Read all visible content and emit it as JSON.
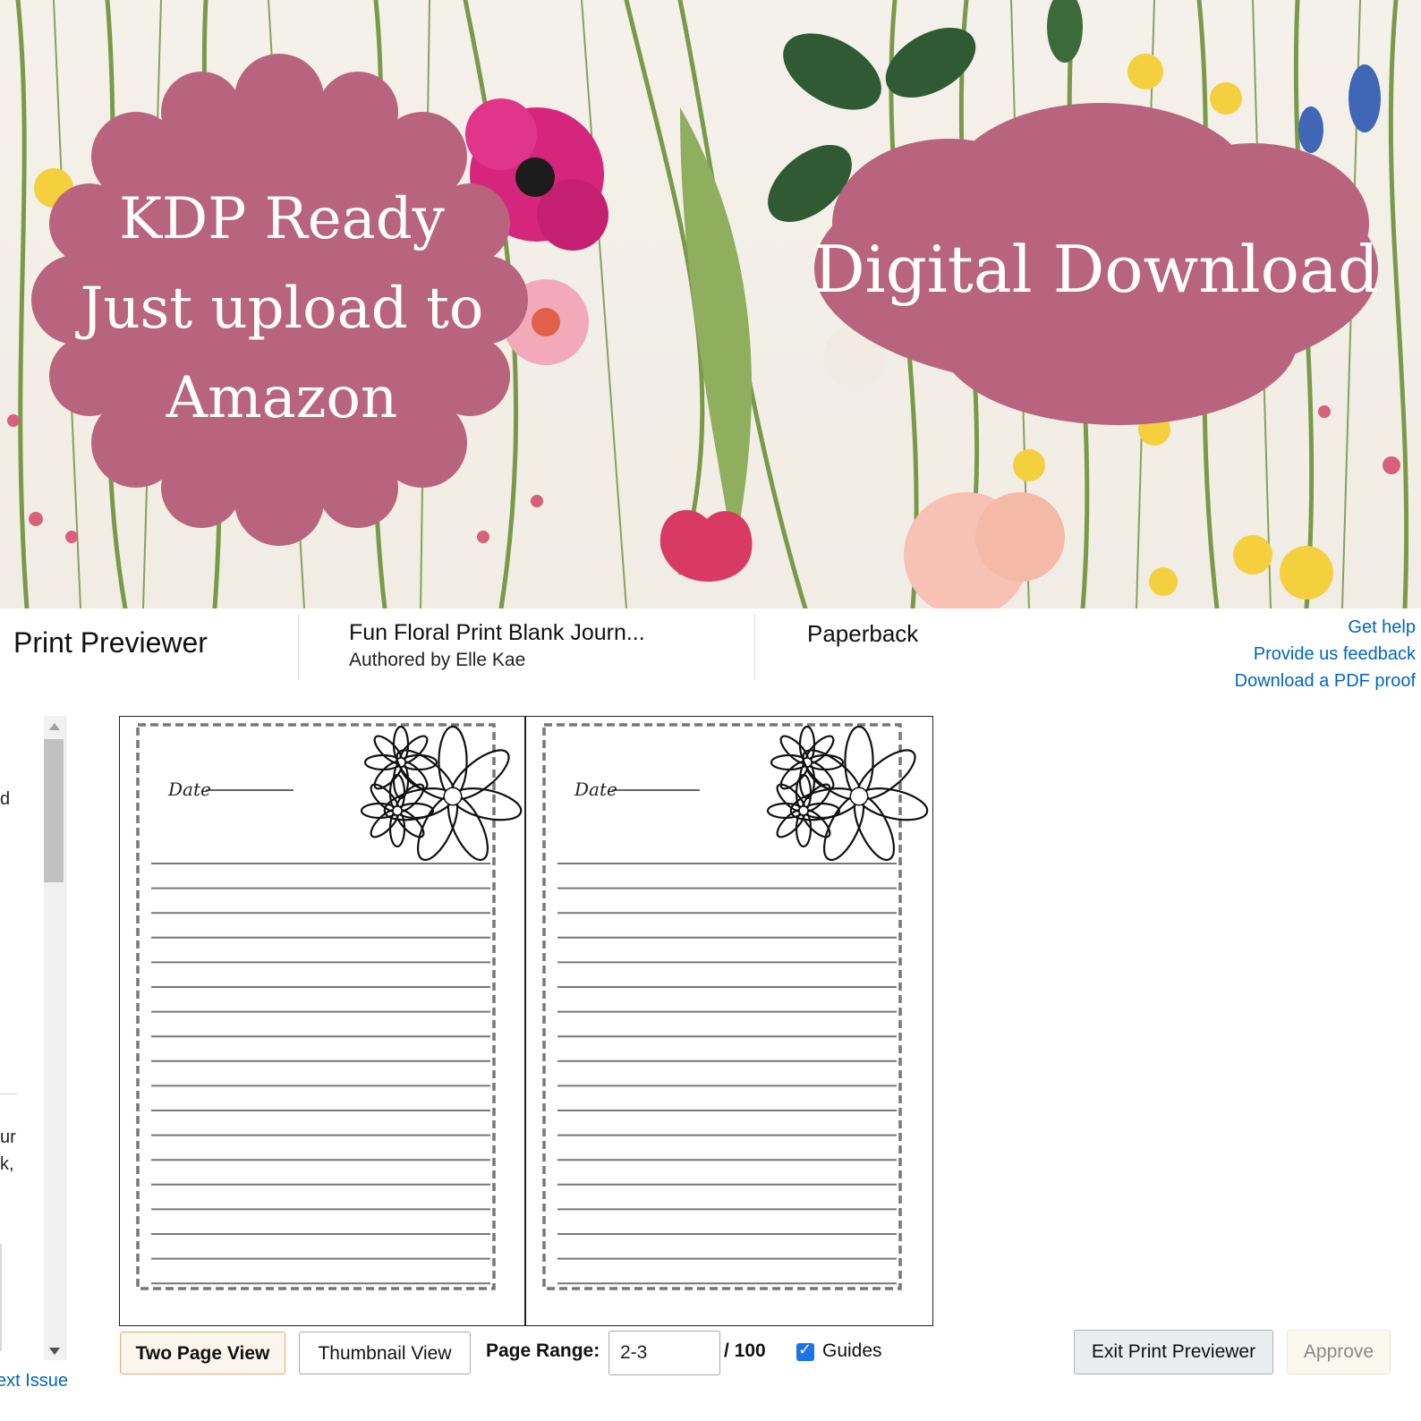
{
  "banner": {
    "badge_left_lines": [
      "KDP Ready",
      "Just upload to",
      "Amazon"
    ],
    "badge_right": "Digital Download",
    "badge_color": "#b9647e"
  },
  "header": {
    "app_title": "Print Previewer",
    "book_title": "Fun Floral Print Blank Journ...",
    "book_author": "Authored by Elle Kae",
    "format": "Paperback",
    "links": {
      "help": "Get help",
      "feedback": "Provide us feedback",
      "pdf_proof": "Download a PDF proof"
    },
    "link_color": "#0066c0"
  },
  "left_panel": {
    "fragments": [
      "d",
      "ur",
      "k,"
    ],
    "next_issue": "ext Issue"
  },
  "preview": {
    "pages": [
      {
        "date_label": "Date"
      },
      {
        "date_label": "Date"
      }
    ]
  },
  "toolbar": {
    "two_page_view": "Two Page View",
    "thumbnail_view": "Thumbnail View",
    "page_range_label": "Page Range:",
    "page_range_value": "2-3",
    "page_total": "/ 100",
    "guides_label": "Guides",
    "guides_checked": true,
    "exit_label": "Exit Print Previewer",
    "approve_label": "Approve"
  }
}
